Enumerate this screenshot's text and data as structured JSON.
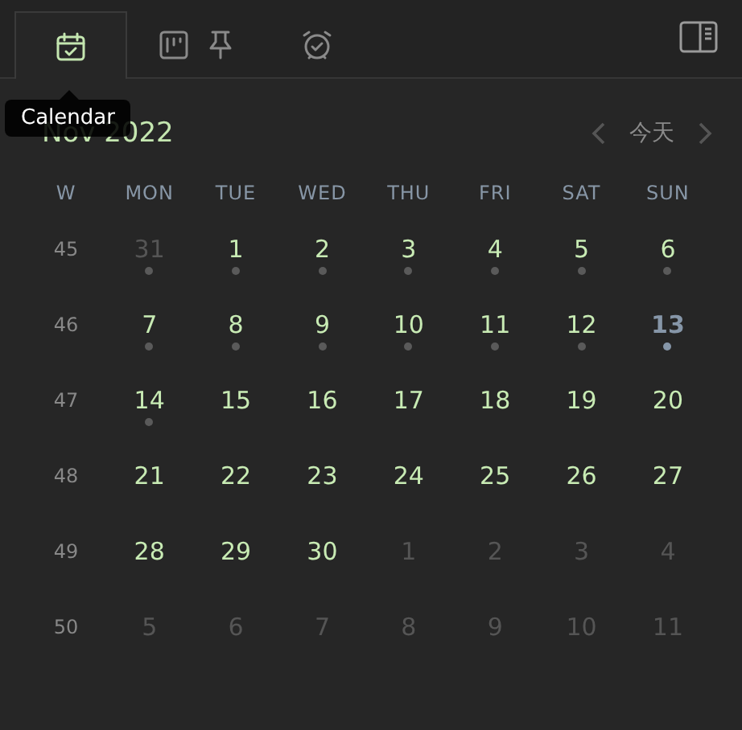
{
  "tabs": [
    {
      "kind": "calendar",
      "selected": true
    },
    {
      "kind": "board",
      "selected": false
    },
    {
      "kind": "alarm",
      "selected": false
    }
  ],
  "tooltip": "Calendar",
  "header": {
    "title": "Nov 2022",
    "today_button": "今天"
  },
  "columns": [
    "W",
    "MON",
    "TUE",
    "WED",
    "THU",
    "FRI",
    "SAT",
    "SUN"
  ],
  "weeks": [
    {
      "week": "45",
      "days": [
        {
          "text": "31",
          "in_month": false,
          "today": false,
          "dot": true
        },
        {
          "text": "1",
          "in_month": true,
          "today": false,
          "dot": true
        },
        {
          "text": "2",
          "in_month": true,
          "today": false,
          "dot": true
        },
        {
          "text": "3",
          "in_month": true,
          "today": false,
          "dot": true
        },
        {
          "text": "4",
          "in_month": true,
          "today": false,
          "dot": true
        },
        {
          "text": "5",
          "in_month": true,
          "today": false,
          "dot": true
        },
        {
          "text": "6",
          "in_month": true,
          "today": false,
          "dot": true
        }
      ]
    },
    {
      "week": "46",
      "days": [
        {
          "text": "7",
          "in_month": true,
          "today": false,
          "dot": true
        },
        {
          "text": "8",
          "in_month": true,
          "today": false,
          "dot": true
        },
        {
          "text": "9",
          "in_month": true,
          "today": false,
          "dot": true
        },
        {
          "text": "10",
          "in_month": true,
          "today": false,
          "dot": true
        },
        {
          "text": "11",
          "in_month": true,
          "today": false,
          "dot": true
        },
        {
          "text": "12",
          "in_month": true,
          "today": false,
          "dot": true
        },
        {
          "text": "13",
          "in_month": true,
          "today": true,
          "dot": true
        }
      ]
    },
    {
      "week": "47",
      "days": [
        {
          "text": "14",
          "in_month": true,
          "today": false,
          "dot": true
        },
        {
          "text": "15",
          "in_month": true,
          "today": false,
          "dot": false
        },
        {
          "text": "16",
          "in_month": true,
          "today": false,
          "dot": false
        },
        {
          "text": "17",
          "in_month": true,
          "today": false,
          "dot": false
        },
        {
          "text": "18",
          "in_month": true,
          "today": false,
          "dot": false
        },
        {
          "text": "19",
          "in_month": true,
          "today": false,
          "dot": false
        },
        {
          "text": "20",
          "in_month": true,
          "today": false,
          "dot": false
        }
      ]
    },
    {
      "week": "48",
      "days": [
        {
          "text": "21",
          "in_month": true,
          "today": false,
          "dot": false
        },
        {
          "text": "22",
          "in_month": true,
          "today": false,
          "dot": false
        },
        {
          "text": "23",
          "in_month": true,
          "today": false,
          "dot": false
        },
        {
          "text": "24",
          "in_month": true,
          "today": false,
          "dot": false
        },
        {
          "text": "25",
          "in_month": true,
          "today": false,
          "dot": false
        },
        {
          "text": "26",
          "in_month": true,
          "today": false,
          "dot": false
        },
        {
          "text": "27",
          "in_month": true,
          "today": false,
          "dot": false
        }
      ]
    },
    {
      "week": "49",
      "days": [
        {
          "text": "28",
          "in_month": true,
          "today": false,
          "dot": false
        },
        {
          "text": "29",
          "in_month": true,
          "today": false,
          "dot": false
        },
        {
          "text": "30",
          "in_month": true,
          "today": false,
          "dot": false
        },
        {
          "text": "1",
          "in_month": false,
          "today": false,
          "dot": false
        },
        {
          "text": "2",
          "in_month": false,
          "today": false,
          "dot": false
        },
        {
          "text": "3",
          "in_month": false,
          "today": false,
          "dot": false
        },
        {
          "text": "4",
          "in_month": false,
          "today": false,
          "dot": false
        }
      ]
    },
    {
      "week": "50",
      "days": [
        {
          "text": "5",
          "in_month": false,
          "today": false,
          "dot": false
        },
        {
          "text": "6",
          "in_month": false,
          "today": false,
          "dot": false
        },
        {
          "text": "7",
          "in_month": false,
          "today": false,
          "dot": false
        },
        {
          "text": "8",
          "in_month": false,
          "today": false,
          "dot": false
        },
        {
          "text": "9",
          "in_month": false,
          "today": false,
          "dot": false
        },
        {
          "text": "10",
          "in_month": false,
          "today": false,
          "dot": false
        },
        {
          "text": "11",
          "in_month": false,
          "today": false,
          "dot": false
        }
      ]
    }
  ]
}
